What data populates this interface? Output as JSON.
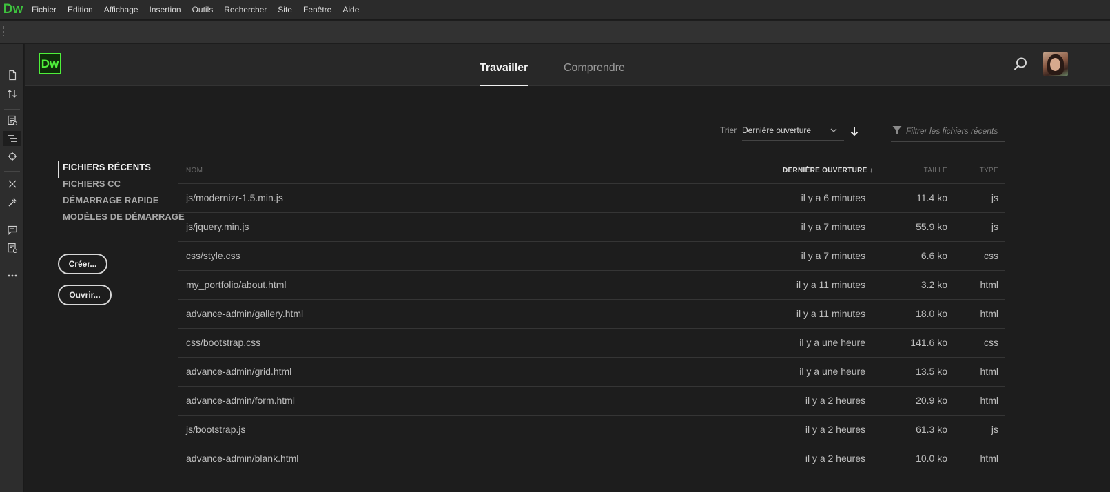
{
  "menubar": {
    "logo": "Dw",
    "items": [
      "Fichier",
      "Edition",
      "Affichage",
      "Insertion",
      "Outils",
      "Rechercher",
      "Site",
      "Fenêtre",
      "Aide"
    ]
  },
  "left_toolbar": {
    "icons": [
      "new-file-icon",
      "file-transfer-icon",
      "live-view-icon",
      "dom-panel-icon",
      "insert-target-icon",
      "code-hint-icon",
      "eyedropper-icon",
      "comment-icon",
      "checklist-icon",
      "more-icon"
    ]
  },
  "header": {
    "logo": "Dw",
    "tabs": [
      "Travailler",
      "Comprendre"
    ],
    "active_tab": "Travailler"
  },
  "sort": {
    "label": "Trier",
    "value": "Dernière ouverture"
  },
  "filter": {
    "placeholder": "Filtrer les fichiers récents"
  },
  "side_nav": {
    "items": [
      "FICHIERS RÉCENTS",
      "FICHIERS CC",
      "DÉMARRAGE RAPIDE",
      "MODÈLES DE DÉMARRAGE"
    ],
    "active": "FICHIERS RÉCENTS",
    "create_label": "Créer...",
    "open_label": "Ouvrir..."
  },
  "table": {
    "columns": [
      "NOM",
      "DERNIÈRE OUVERTURE ↓",
      "TAILLE",
      "TYPE"
    ],
    "rows": [
      {
        "name": "js/modernizr-1.5.min.js",
        "date": "il y a 6 minutes",
        "size": "11.4 ko",
        "type": "js"
      },
      {
        "name": "js/jquery.min.js",
        "date": "il y a 7 minutes",
        "size": "55.9 ko",
        "type": "js"
      },
      {
        "name": "css/style.css",
        "date": "il y a 7 minutes",
        "size": "6.6 ko",
        "type": "css"
      },
      {
        "name": "my_portfolio/about.html",
        "date": "il y a 11 minutes",
        "size": "3.2 ko",
        "type": "html"
      },
      {
        "name": "advance-admin/gallery.html",
        "date": "il y a 11 minutes",
        "size": "18.0 ko",
        "type": "html"
      },
      {
        "name": "css/bootstrap.css",
        "date": "il y a une heure",
        "size": "141.6 ko",
        "type": "css"
      },
      {
        "name": "advance-admin/grid.html",
        "date": "il y a une heure",
        "size": "13.5 ko",
        "type": "html"
      },
      {
        "name": "advance-admin/form.html",
        "date": "il y a 2 heures",
        "size": "20.9 ko",
        "type": "html"
      },
      {
        "name": "js/bootstrap.js",
        "date": "il y a 2 heures",
        "size": "61.3 ko",
        "type": "js"
      },
      {
        "name": "advance-admin/blank.html",
        "date": "il y a 2 heures",
        "size": "10.0 ko",
        "type": "html"
      }
    ]
  },
  "colors": {
    "brand": "#4ef03a",
    "background": "#1d1d1d",
    "header": "#282828"
  }
}
